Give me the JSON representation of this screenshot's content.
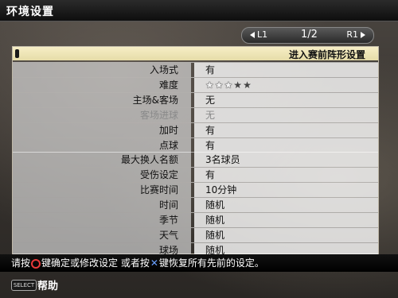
{
  "title": "环境设置",
  "pager": {
    "left_btn": "L1",
    "page": "1/2",
    "right_btn": "R1"
  },
  "panel": {
    "header": "进入赛前阵形设置",
    "rows": [
      {
        "label": "入场式",
        "value": "有"
      },
      {
        "label": "难度",
        "stars_on": 3,
        "stars_total": 5
      },
      {
        "label": "主场&客场",
        "value": "无"
      },
      {
        "label": "客场进球",
        "value": "无",
        "disabled": true
      },
      {
        "label": "加时",
        "value": "有"
      },
      {
        "label": "点球",
        "value": "有"
      },
      {
        "label": "最大换人名额",
        "value": "3名球员"
      },
      {
        "label": "受伤设定",
        "value": "有"
      },
      {
        "label": "比赛时间",
        "value": "10分钟"
      },
      {
        "label": "时间",
        "value": "随机"
      },
      {
        "label": "季节",
        "value": "随机"
      },
      {
        "label": "天气",
        "value": "随机"
      },
      {
        "label": "球场",
        "value": "随机"
      }
    ]
  },
  "footer": {
    "part1": "请按",
    "part2": "键确定或修改设定 或者按",
    "part3": "键恢复所有先前的设定。"
  },
  "help": {
    "select_label": "SELECT",
    "label": "帮助"
  },
  "colors": {
    "header_bg": "#f0e6b8",
    "circle_button": "#e83a3a",
    "cross_button": "#6aa0ff"
  }
}
